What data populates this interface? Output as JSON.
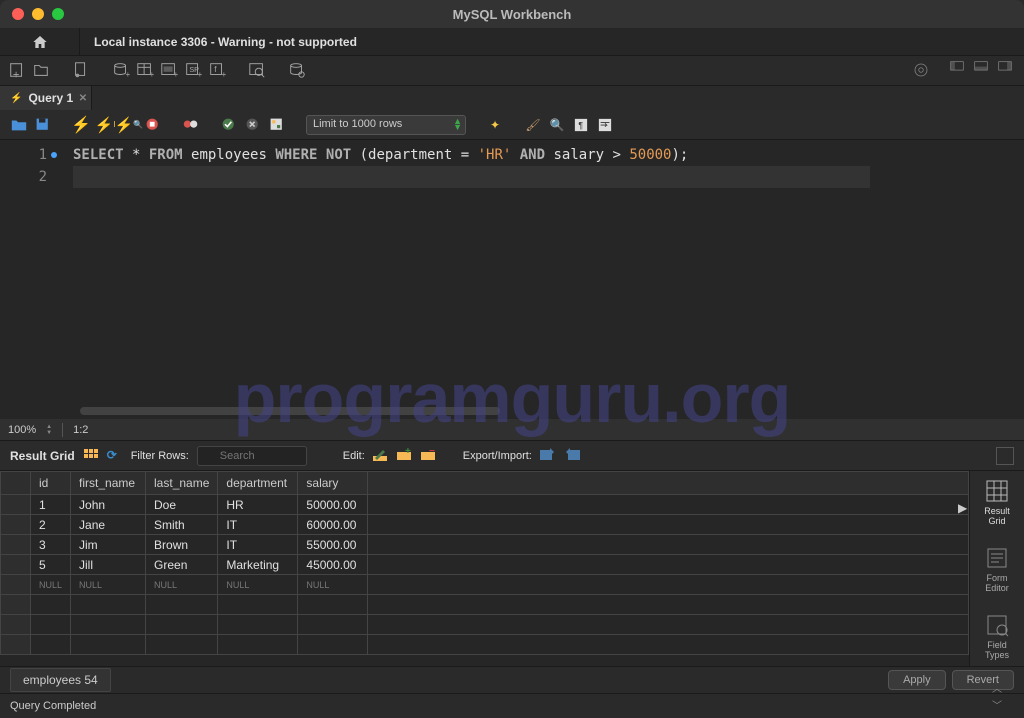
{
  "title": "MySQL Workbench",
  "connection_tab": "Local instance 3306 - Warning - not supported",
  "query_tab": "Query 1",
  "limit": "Limit to 1000 rows",
  "zoom": "100%",
  "cursor_pos": "1:2",
  "sql": {
    "kw1": "SELECT",
    "star": " * ",
    "kw2": "FROM",
    "tbl": " employees ",
    "kw3": "WHERE NOT",
    "paren1": " (department = ",
    "str1": "'HR'",
    "kw4": " AND",
    "col2": " salary > ",
    "num1": "50000",
    "paren2": ");"
  },
  "result_toolbar": {
    "title": "Result Grid",
    "filter_label": "Filter Rows:",
    "search_placeholder": "Search",
    "edit_label": "Edit:",
    "export_label": "Export/Import:"
  },
  "columns": [
    "id",
    "first_name",
    "last_name",
    "department",
    "salary"
  ],
  "rows": [
    {
      "id": "1",
      "first_name": "John",
      "last_name": "Doe",
      "department": "HR",
      "salary": "50000.00"
    },
    {
      "id": "2",
      "first_name": "Jane",
      "last_name": "Smith",
      "department": "IT",
      "salary": "60000.00"
    },
    {
      "id": "3",
      "first_name": "Jim",
      "last_name": "Brown",
      "department": "IT",
      "salary": "55000.00"
    },
    {
      "id": "5",
      "first_name": "Jill",
      "last_name": "Green",
      "department": "Marketing",
      "salary": "45000.00"
    }
  ],
  "null_text": "NULL",
  "side": {
    "result_grid": "Result Grid",
    "form_editor": "Form Editor",
    "field_types": "Field Types"
  },
  "bottom_tab": "employees 54",
  "apply": "Apply",
  "revert": "Revert",
  "status": "Query Completed",
  "watermark": "programguru.org"
}
